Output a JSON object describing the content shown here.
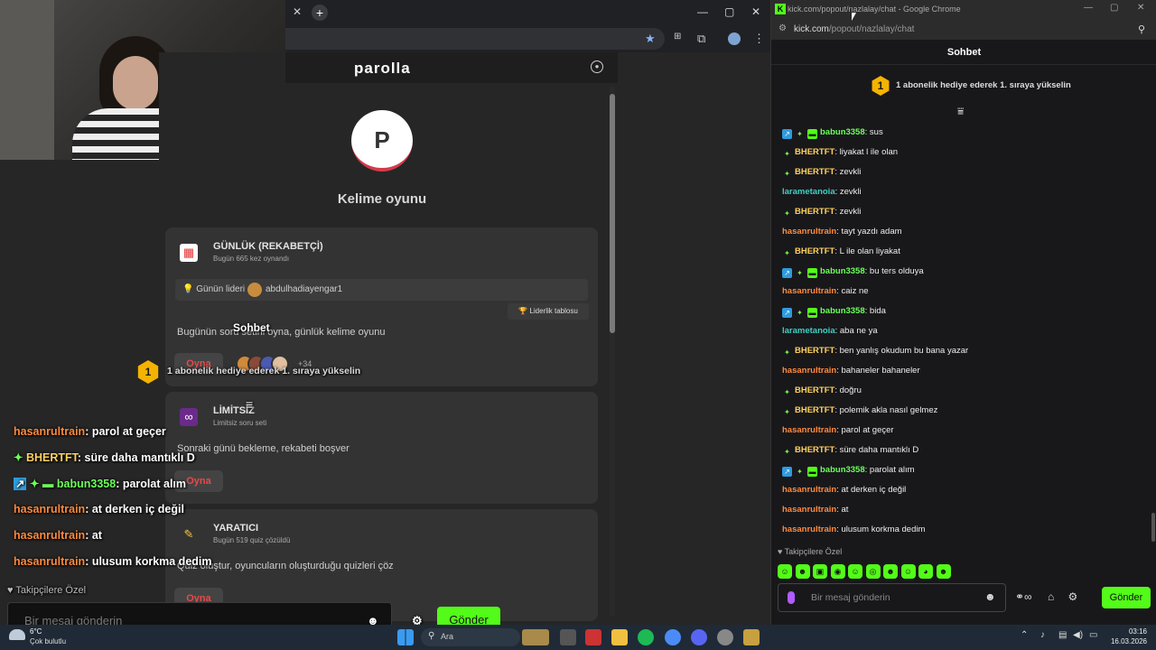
{
  "left_browser": {
    "site_title": "parolla",
    "logo_letter": "P",
    "game_title": "Kelime oyunu",
    "cards": [
      {
        "title": "GÜNLÜK (REKABETÇİ)",
        "subtitle": "Bugün 665 kez oynandı",
        "leader_label": "Günün lideri",
        "leader_name": "abdulhadiayengar1",
        "leaderboard_btn": "🏆 Liderlik tablosu",
        "desc": "Bugünün soru setini oyna, günlük kelime oyunu",
        "play": "Oyna",
        "extra_players": "+34"
      },
      {
        "title": "LİMİTSİZ",
        "subtitle": "Limitsiz soru seti",
        "desc": "Sonraki günü bekleme, rekabeti boşver",
        "play": "Oyna"
      },
      {
        "title": "YARATICI",
        "subtitle": "Bugün 519 quiz çözüldü",
        "desc": "Quiz oluştur, oyuncuların oluşturduğu quizleri çöz",
        "play": "Oyna"
      }
    ]
  },
  "overlay": {
    "header": "Sohbet",
    "goal_rank": "1",
    "goal_text": "1 abonelik hediye ederek 1. sıraya yükselin",
    "messages": [
      {
        "user": "hasanrultrain",
        "text": ": parol at geçer"
      },
      {
        "user": "BHERTFT",
        "text": ": süre daha mantıklı D"
      },
      {
        "user": "babun3358",
        "text": ": parolat alım"
      },
      {
        "user": "hasanrultrain",
        "text": ": at derken iç değil"
      },
      {
        "user": "hasanrultrain",
        "text": ": at"
      },
      {
        "user": "hasanrultrain",
        "text": ": ulusum korkma dedim"
      }
    ],
    "follower_only": "♥ Takipçilere Özel",
    "input_placeholder": "Bir mesaj gönderin",
    "send": "Gönder"
  },
  "popup": {
    "window_title": "kick.com/popout/nazlalay/chat - Google Chrome",
    "url_host": "kick.com",
    "url_path": "/popout/nazlalay/chat",
    "chat_title": "Sohbet",
    "goal_rank": "1",
    "goal_text": "1 abonelik hediye ederek 1. sıraya yükselin",
    "messages": [
      {
        "user": "babun3358",
        "text": ": sus",
        "color": "green",
        "badges": [
          "mod",
          "vip",
          "sub"
        ]
      },
      {
        "user": "BHERTFT",
        "text": ": liyakat l ile olan",
        "color": "yellow",
        "badges": [
          "vip"
        ]
      },
      {
        "user": "BHERTFT",
        "text": ": zevkli",
        "color": "yellow",
        "badges": [
          "vip"
        ]
      },
      {
        "user": "larametanoia",
        "text": ": zevkli",
        "color": "teal",
        "badges": []
      },
      {
        "user": "BHERTFT",
        "text": ": zevkli",
        "color": "yellow",
        "badges": [
          "vip"
        ]
      },
      {
        "user": "hasanrultrain",
        "text": ": tayt yazdı adam",
        "color": "orange",
        "badges": []
      },
      {
        "user": "BHERTFT",
        "text": ": L ile olan liyakat",
        "color": "yellow",
        "badges": [
          "vip"
        ]
      },
      {
        "user": "babun3358",
        "text": ": bu ters olduya",
        "color": "green",
        "badges": [
          "mod",
          "vip",
          "sub"
        ]
      },
      {
        "user": "hasanrultrain",
        "text": ": caiz ne",
        "color": "orange",
        "badges": []
      },
      {
        "user": "babun3358",
        "text": ": bida",
        "color": "green",
        "badges": [
          "mod",
          "vip",
          "sub"
        ]
      },
      {
        "user": "larametanoia",
        "text": ": aba ne ya",
        "color": "teal",
        "badges": []
      },
      {
        "user": "BHERTFT",
        "text": ": ben yanlış okudum bu bana yazar",
        "color": "yellow",
        "badges": [
          "vip"
        ]
      },
      {
        "user": "hasanrultrain",
        "text": ": bahaneler bahaneler",
        "color": "orange",
        "badges": []
      },
      {
        "user": "BHERTFT",
        "text": ": doğru",
        "color": "yellow",
        "badges": [
          "vip"
        ]
      },
      {
        "user": "BHERTFT",
        "text": ": polemik akla nasıl gelmez",
        "color": "yellow",
        "badges": [
          "vip"
        ]
      },
      {
        "user": "hasanrultrain",
        "text": ": parol at geçer",
        "color": "orange",
        "badges": []
      },
      {
        "user": "BHERTFT",
        "text": ": süre daha mantıklı D",
        "color": "yellow",
        "badges": [
          "vip"
        ]
      },
      {
        "user": "babun3358",
        "text": ": parolat alım",
        "color": "green",
        "badges": [
          "mod",
          "vip",
          "sub"
        ]
      },
      {
        "user": "hasanrultrain",
        "text": ": at derken iç değil",
        "color": "orange",
        "badges": []
      },
      {
        "user": "hasanrultrain",
        "text": ": at",
        "color": "orange",
        "badges": []
      },
      {
        "user": "hasanrultrain",
        "text": ": ulusum korkma dedim",
        "color": "orange",
        "badges": []
      }
    ],
    "follower_only": "♥ Takipçilere Özel",
    "input_placeholder": "Bir mesaj gönderin",
    "send": "Gönder"
  },
  "taskbar": {
    "weather_temp": "6°C",
    "weather_desc": "Çok bulutlu",
    "search_label": "Ara",
    "time": "03:16",
    "date": "16.03.2026"
  },
  "colors": {
    "kick_green": "#53fc18",
    "play_red": "#e54b4b",
    "badge_gold": "#f5b301"
  }
}
